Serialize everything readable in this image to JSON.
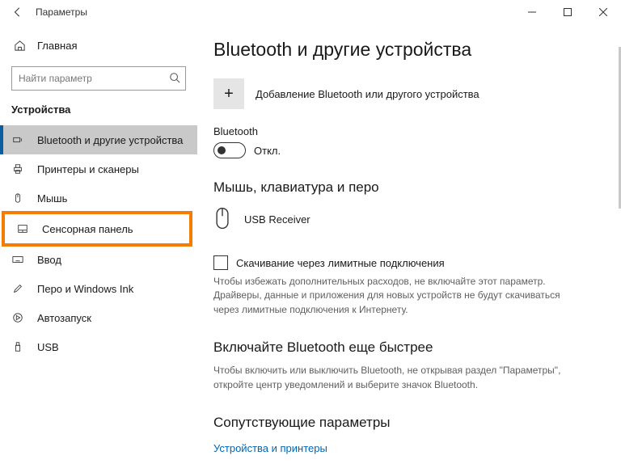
{
  "window": {
    "title": "Параметры"
  },
  "sidebar": {
    "home": "Главная",
    "search_placeholder": "Найти параметр",
    "section": "Устройства",
    "items": [
      {
        "label": "Bluetooth и другие устройства"
      },
      {
        "label": "Принтеры и сканеры"
      },
      {
        "label": "Мышь"
      },
      {
        "label": "Сенсорная панель"
      },
      {
        "label": "Ввод"
      },
      {
        "label": "Перо и Windows Ink"
      },
      {
        "label": "Автозапуск"
      },
      {
        "label": "USB"
      }
    ]
  },
  "main": {
    "title": "Bluetooth и другие устройства",
    "add_label": "Добавление Bluetooth или другого устройства",
    "bluetooth_label": "Bluetooth",
    "bluetooth_state": "Откл.",
    "mouse_section": "Мышь, клавиатура и перо",
    "device0": "USB Receiver",
    "metered_check": "Скачивание через лимитные подключения",
    "metered_hint": "Чтобы избежать дополнительных расходов, не включайте этот параметр. Драйверы, данные и приложения для новых устройств не будут скачиваться через лимитные подключения к Интернету.",
    "faster_title": "Включайте Bluetooth еще быстрее",
    "faster_hint": "Чтобы включить или выключить Bluetooth, не открывая раздел \"Параметры\", откройте центр уведомлений и выберите значок Bluetooth.",
    "related_title": "Сопутствующие параметры",
    "related_link": "Устройства и принтеры"
  }
}
